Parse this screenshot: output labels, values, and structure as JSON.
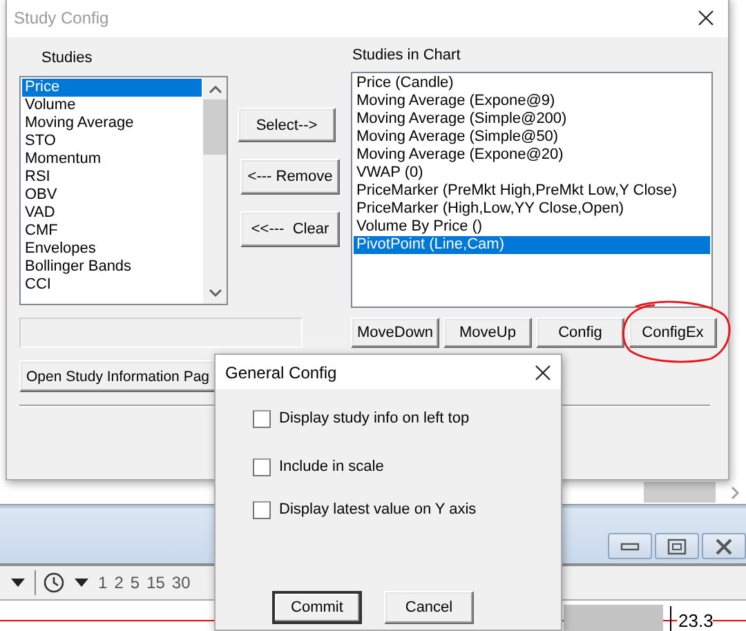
{
  "study_config": {
    "title": "Study Config",
    "studies_label": "Studies",
    "studies": [
      {
        "label": "Price",
        "selected": true
      },
      {
        "label": "Volume",
        "selected": false
      },
      {
        "label": "Moving Average",
        "selected": false
      },
      {
        "label": "STO",
        "selected": false
      },
      {
        "label": "Momentum",
        "selected": false
      },
      {
        "label": "RSI",
        "selected": false
      },
      {
        "label": "OBV",
        "selected": false
      },
      {
        "label": "VAD",
        "selected": false
      },
      {
        "label": "CMF",
        "selected": false
      },
      {
        "label": "Envelopes",
        "selected": false
      },
      {
        "label": "Bollinger Bands",
        "selected": false
      },
      {
        "label": "CCI",
        "selected": false
      }
    ],
    "move_buttons": [
      "Select-->",
      "<--- Remove",
      "<<---  Clear"
    ],
    "info_button": "Open Study Information Pag",
    "chart_label": "Studies in Chart",
    "chart_studies": [
      {
        "label": "Price (Candle)",
        "selected": false
      },
      {
        "label": "Moving Average (Expone@9)",
        "selected": false
      },
      {
        "label": "Moving Average (Simple@200)",
        "selected": false
      },
      {
        "label": "Moving Average (Simple@50)",
        "selected": false
      },
      {
        "label": "Moving Average (Expone@20)",
        "selected": false
      },
      {
        "label": "VWAP (0)",
        "selected": false
      },
      {
        "label": "PriceMarker (PreMkt High,PreMkt Low,Y Close)",
        "selected": false
      },
      {
        "label": "PriceMarker (High,Low,YY Close,Open)",
        "selected": false
      },
      {
        "label": "Volume By Price ()",
        "selected": false
      },
      {
        "label": "PivotPoint (Line,Cam)",
        "selected": true
      }
    ],
    "chart_buttons": [
      {
        "label": "MoveDown",
        "highlighted": false
      },
      {
        "label": "MoveUp",
        "highlighted": false
      },
      {
        "label": "Config",
        "highlighted": false
      },
      {
        "label": "ConfigEx",
        "highlighted": true
      }
    ]
  },
  "general_config": {
    "title": "General Config",
    "options": [
      {
        "label": "Display study info on left top",
        "checked": false
      },
      {
        "label": "Include in scale",
        "checked": false
      },
      {
        "label": "Display latest value on Y axis",
        "checked": false
      }
    ],
    "buttons": [
      {
        "label": "Commit",
        "default": true
      },
      {
        "label": "Cancel",
        "default": false
      }
    ]
  },
  "background_window": {
    "intervals": [
      "1",
      "2",
      "5",
      "15",
      "30"
    ],
    "price_label": "23.3"
  }
}
